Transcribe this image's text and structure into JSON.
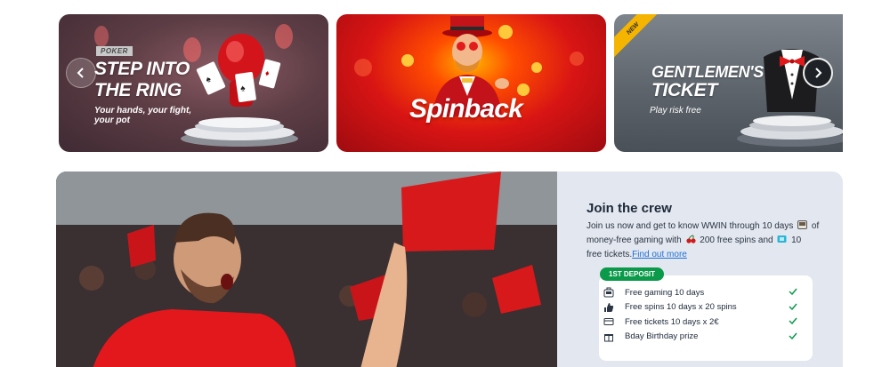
{
  "carousel": {
    "banners": [
      {
        "tag": "POKER",
        "title_line1": "STEP INTO",
        "title_line2": "THE RING",
        "subtitle_line1": "Your hands, your fight,",
        "subtitle_line2": "your pot"
      },
      {
        "title": "Spinback"
      },
      {
        "badge": "NEW",
        "title_line1": "GENTLEMEN'S",
        "title_line2": "TICKET",
        "subtitle": "Play risk free"
      }
    ],
    "prev_icon": "chevron-left-icon",
    "next_icon": "chevron-right-icon"
  },
  "join": {
    "title": "Join the crew",
    "text_part1": "Join us now and get to know WWIN through 10 days",
    "text_part2": "of money-free gaming with",
    "text_part3": "200 free spins and",
    "text_part4": "10",
    "text_part5": "free tickets.",
    "link": "Find out more",
    "deposit_badge": "1ST DEPOSIT",
    "features": [
      {
        "label": "Free gaming 10 days",
        "icon": "gamepad-icon"
      },
      {
        "label": "Free spins 10 days x 20 spins",
        "icon": "thumbs-up-icon"
      },
      {
        "label": "Free tickets 10 days x 2€",
        "icon": "ticket-icon"
      },
      {
        "label": "Bday Birthday prize",
        "icon": "gift-icon"
      }
    ]
  },
  "colors": {
    "accent_green": "#0a9a4a",
    "link_blue": "#1d6fd8",
    "panel_bg": "#e3e7ef"
  }
}
